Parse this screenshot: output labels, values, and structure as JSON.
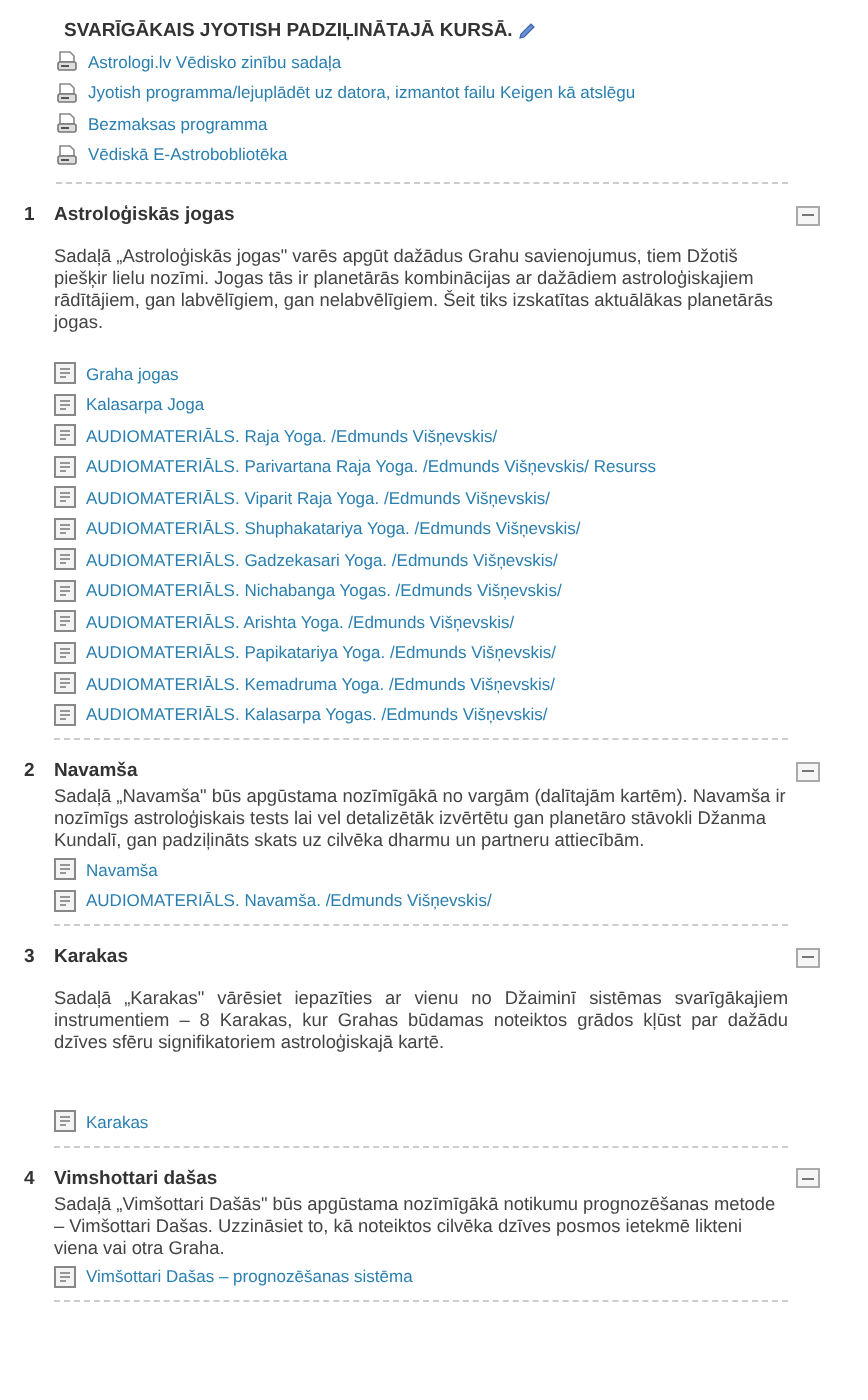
{
  "intro": {
    "title": "SVARĪGĀKAIS JYOTISH PADZIĻINĀTAJĀ KURSĀ.",
    "resources": [
      {
        "kind": "file",
        "label": "Astrologi.lv Vēdisko zinību sadaļa"
      },
      {
        "kind": "file",
        "label": "Jyotish programma/lejuplādēt uz datora, izmantot failu Keigen kā atslēgu"
      },
      {
        "kind": "file",
        "label": "Bezmaksas programma"
      },
      {
        "kind": "file",
        "label": "Vēdiskā E-Astrobobliotēka"
      }
    ]
  },
  "sections": [
    {
      "number": "1",
      "title": "Astroloģiskās jogas",
      "description": "Sadaļā „Astroloģiskās jogas\" varēs apgūt dažādus Grahu savienojumus, tiem Džotiš piešķir lielu nozīmi. Jogas tās ir planetārās kombinācijas ar dažādiem astroloģiskajiem rādītājiem, gan labvēlīgiem, gan nelabvēlīgiem. Šeit tiks izskatītas aktuālākas planetārās jogas.",
      "resources": [
        {
          "kind": "page",
          "label": "Graha jogas"
        },
        {
          "kind": "page",
          "label": "Kalasarpa Joga"
        },
        {
          "kind": "page",
          "label": "AUDIOMATERIĀLS. Raja Yoga. /Edmunds Višņevskis/"
        },
        {
          "kind": "page",
          "label": "AUDIOMATERIĀLS. Parivartana Raja Yoga. /Edmunds Višņevskis/ Resurss"
        },
        {
          "kind": "page",
          "label": "AUDIOMATERIĀLS. Viparit Raja Yoga. /Edmunds Višņevskis/"
        },
        {
          "kind": "page",
          "label": "AUDIOMATERIĀLS. Shuphakatariya Yoga. /Edmunds Višņevskis/"
        },
        {
          "kind": "page",
          "label": "AUDIOMATERIĀLS. Gadzekasari Yoga. /Edmunds Višņevskis/"
        },
        {
          "kind": "page",
          "label": "AUDIOMATERIĀLS. Nichabanga Yogas. /Edmunds Višņevskis/"
        },
        {
          "kind": "page",
          "label": "AUDIOMATERIĀLS. Arishta Yoga. /Edmunds Višņevskis/"
        },
        {
          "kind": "page",
          "label": "AUDIOMATERIĀLS. Papikatariya Yoga. /Edmunds Višņevskis/"
        },
        {
          "kind": "page",
          "label": "AUDIOMATERIĀLS. Kemadruma Yoga. /Edmunds Višņevskis/"
        },
        {
          "kind": "page",
          "label": "AUDIOMATERIĀLS. Kalasarpa Yogas. /Edmunds Višņevskis/"
        }
      ]
    },
    {
      "number": "2",
      "title": "Navamša",
      "description": "Sadaļā „Navamša\" būs apgūstama nozīmīgākā no vargām (dalītajām kartēm). Navamša ir nozīmīgs astroloģiskais tests lai vel detalizētāk izvērtētu gan planetāro stāvokli Džanma Kundalī, gan padziļināts skats uz cilvēka dharmu un partneru attiecībām.",
      "resources": [
        {
          "kind": "page",
          "label": "Navamša"
        },
        {
          "kind": "page",
          "label": "AUDIOMATERIĀLS. Navamša. /Edmunds Višņevskis/"
        }
      ]
    },
    {
      "number": "3",
      "title": "Karakas",
      "description": "Sadaļā „Karakas\" vārēsiet iepazīties ar vienu no Džaiminī sistēmas svarīgākajiem instrumentiem – 8 Karakas, kur Grahas būdamas noteiktos grādos kļūst par dažādu dzīves sfēru signifikatoriem astroloģiskajā kartē.",
      "resources": [
        {
          "kind": "page",
          "label": "Karakas"
        }
      ]
    },
    {
      "number": "4",
      "title": "Vimshottari dašas",
      "description": "Sadaļā „Vimšottari Dašās\" būs apgūstama nozīmīgākā notikumu prognozēšanas metode – Vimšottari Dašas. Uzzināsiet to, kā noteiktos cilvēka dzīves posmos ietekmē likteni viena vai otra Graha.",
      "resources": [
        {
          "kind": "page",
          "label": "Vimšottari Dašas – prognozēšanas sistēma"
        }
      ]
    }
  ]
}
